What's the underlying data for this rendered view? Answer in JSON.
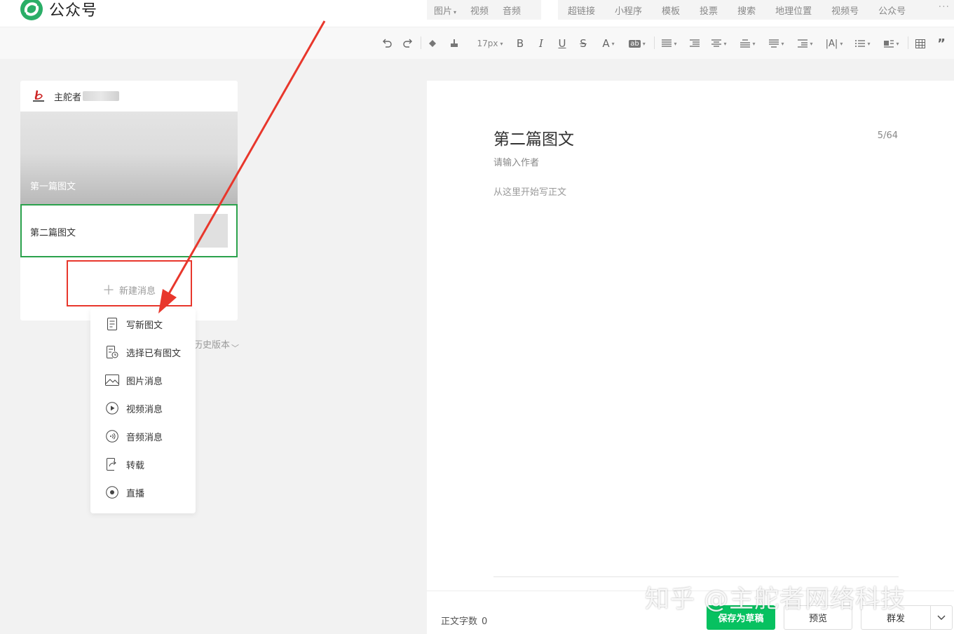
{
  "app": {
    "title": "公众号"
  },
  "insert_menu": [
    {
      "label": "图片",
      "has_caret": true
    },
    {
      "label": "视频"
    },
    {
      "label": "音频"
    },
    {
      "label": "超链接"
    },
    {
      "label": "小程序"
    },
    {
      "label": "模板"
    },
    {
      "label": "投票"
    },
    {
      "label": "搜索"
    },
    {
      "label": "地理位置"
    },
    {
      "label": "视频号"
    },
    {
      "label": "公众号"
    }
  ],
  "toolbar": {
    "font_size": "17px",
    "icons": [
      "undo-icon",
      "redo-icon",
      "format-painter-icon",
      "clear-format-icon",
      "font-size-select",
      "bold-icon",
      "italic-icon",
      "underline-icon",
      "strikethrough-icon",
      "font-color-icon",
      "background-color-icon",
      "align-icon",
      "indent-icon",
      "line-height-icon",
      "paragraph-before-icon",
      "paragraph-after-icon",
      "paragraph-indent-icon",
      "letter-spacing-icon",
      "list-icon",
      "float-icon",
      "table-icon",
      "quote-icon"
    ]
  },
  "message_panel": {
    "account_name": "主舵者",
    "articles": [
      {
        "title": "第一篇图文"
      },
      {
        "title": "第二篇图文",
        "selected": true
      }
    ],
    "new_message_label": "新建消息",
    "history_label": "历史版本"
  },
  "new_message_menu": [
    {
      "label": "写新图文",
      "icon": "article-icon"
    },
    {
      "label": "选择已有图文",
      "icon": "existing-article-icon"
    },
    {
      "label": "图片消息",
      "icon": "image-icon"
    },
    {
      "label": "视频消息",
      "icon": "video-icon"
    },
    {
      "label": "音频消息",
      "icon": "audio-icon"
    },
    {
      "label": "转载",
      "icon": "repost-icon"
    },
    {
      "label": "直播",
      "icon": "live-icon"
    }
  ],
  "editor": {
    "title": "第二篇图文",
    "title_count": "5/64",
    "author_placeholder": "请输入作者",
    "body_placeholder": "从这里开始写正文"
  },
  "footer": {
    "word_count_label": "正文字数",
    "word_count_value": "0",
    "save_draft_label": "保存为草稿",
    "preview_label": "预览",
    "publish_label": "群发"
  },
  "watermark": "知乎 @主舵者网络科技",
  "colors": {
    "accent_green": "#07c160",
    "selected_border": "#2ba24c",
    "annotation_red": "#e8372c"
  }
}
